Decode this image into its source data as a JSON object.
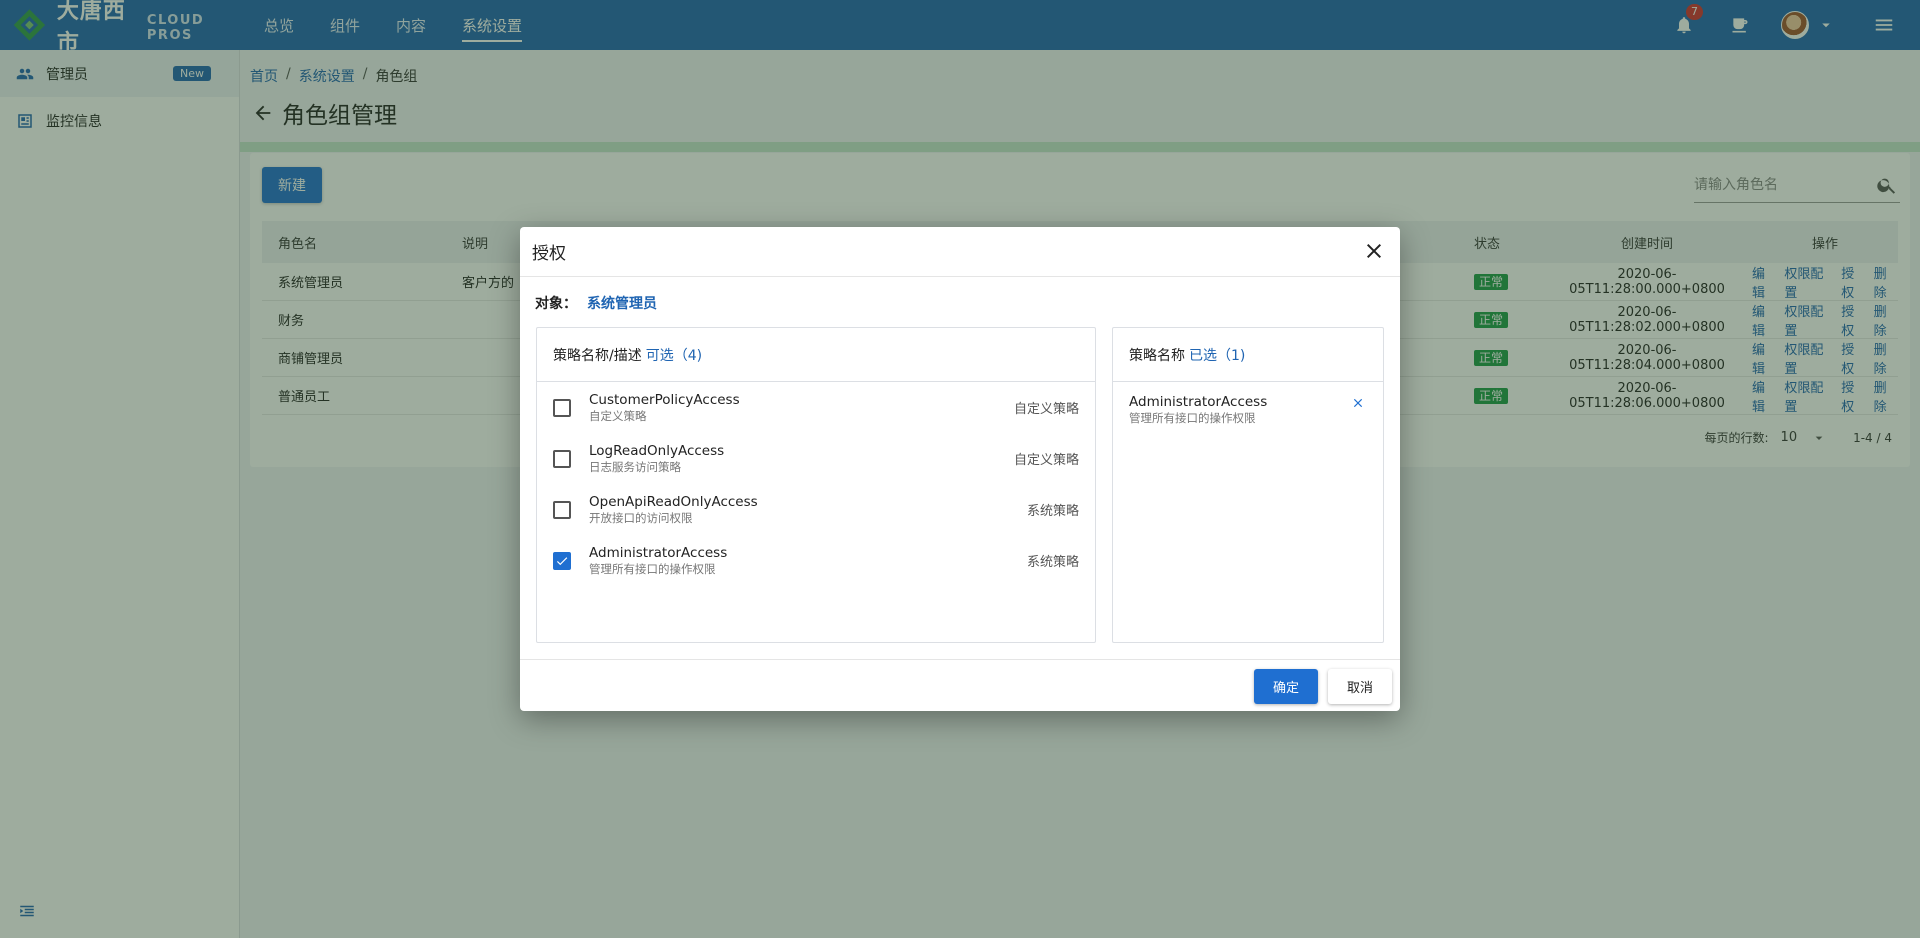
{
  "colors": {
    "primary": "#1f64b2",
    "button": "#1f6fd1",
    "success": "#1c9b47",
    "badge": "#d32f2f"
  },
  "header": {
    "logo_text": "大唐西市",
    "logo_sub": "CLOUD PROS",
    "nav": [
      {
        "label": "总览"
      },
      {
        "label": "组件"
      },
      {
        "label": "内容"
      },
      {
        "label": "系统设置"
      }
    ],
    "notification_count": "7",
    "icons": [
      "bell-icon",
      "cup-icon",
      "avatar",
      "caret-down-icon",
      "menu-icon"
    ]
  },
  "sidebar": {
    "items": [
      {
        "label": "管理员",
        "badge": "New",
        "icon": "people-icon"
      },
      {
        "label": "监控信息",
        "icon": "monitor-icon"
      }
    ]
  },
  "breadcrumb": {
    "home": "首页",
    "settings": "系统设置",
    "current": "角色组"
  },
  "page": {
    "title": "角色组管理"
  },
  "toolbar": {
    "new_label": "新建",
    "search_placeholder": "请输入角色名"
  },
  "table": {
    "headers": {
      "name": "角色名",
      "desc": "说明",
      "status": "状态",
      "time": "创建时间",
      "ops": "操作"
    },
    "rows": [
      {
        "name": "系统管理员",
        "desc": "客户方的",
        "status": "正常",
        "time": "2020-06-05T11:28:00.000+0800"
      },
      {
        "name": "财务",
        "desc": "",
        "status": "正常",
        "time": "2020-06-05T11:28:02.000+0800"
      },
      {
        "name": "商铺管理员",
        "desc": "",
        "status": "正常",
        "time": "2020-06-05T11:28:04.000+0800"
      },
      {
        "name": "普通员工",
        "desc": "",
        "status": "正常",
        "time": "2020-06-05T11:28:06.000+0800"
      }
    ],
    "ops": {
      "edit": "编辑",
      "perm": "权限配置",
      "grant": "授权",
      "delete": "删除"
    }
  },
  "pager": {
    "rows_label": "每页的行数:",
    "rows_value": "10",
    "range": "1-4 / 4"
  },
  "modal": {
    "title": "授权",
    "subject_label": "对象：",
    "subject_value": "系统管理员",
    "left": {
      "head": "策略名称/描述",
      "count": "可选（4)",
      "policies": [
        {
          "name": "CustomerPolicyAccess",
          "desc": "自定义策略",
          "type": "自定义策略",
          "checked": false
        },
        {
          "name": "LogReadOnlyAccess",
          "desc": "日志服务访问策略",
          "type": "自定义策略",
          "checked": false
        },
        {
          "name": "OpenApiReadOnlyAccess",
          "desc": "开放接口的访问权限",
          "type": "系统策略",
          "checked": false
        },
        {
          "name": "AdministratorAccess",
          "desc": "管理所有接口的操作权限",
          "type": "系统策略",
          "checked": true
        }
      ]
    },
    "right": {
      "head": "策略名称",
      "count": "已选（1)",
      "selected": [
        {
          "name": "AdministratorAccess",
          "desc": "管理所有接口的操作权限"
        }
      ]
    },
    "ok_label": "确定",
    "cancel_label": "取消"
  }
}
